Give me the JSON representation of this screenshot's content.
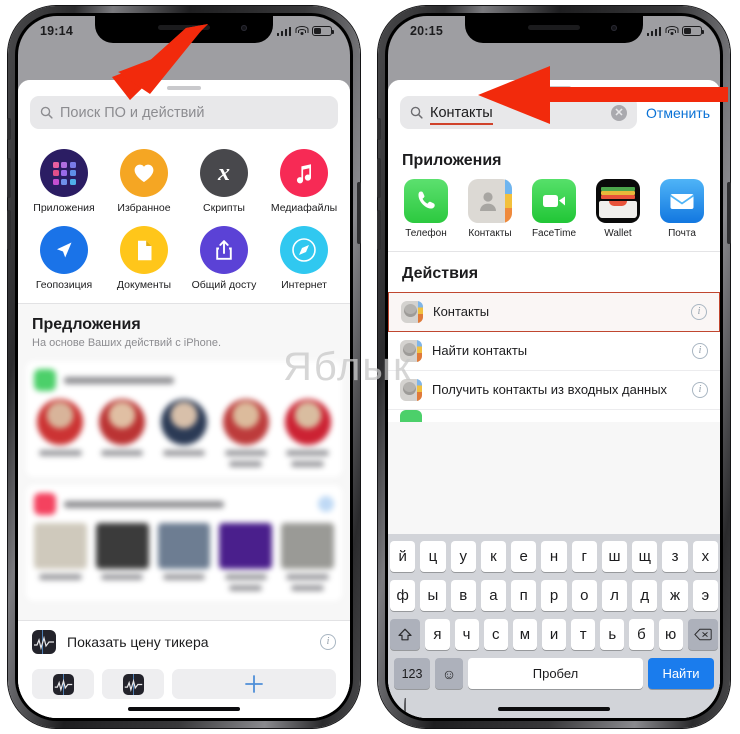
{
  "watermark": {
    "text": "Яблык"
  },
  "left_phone": {
    "status": {
      "time": "19:14",
      "cellular_icon": "signal-bars-icon",
      "wifi_icon": "wifi-icon",
      "battery_icon": "battery-icon"
    },
    "search": {
      "placeholder": "Поиск ПО и действий",
      "icon": "search-icon"
    },
    "categories": [
      {
        "label": "Приложения",
        "icon": "apps-grid-icon",
        "color": "#2b1d63"
      },
      {
        "label": "Избранное",
        "icon": "heart-icon",
        "color": "#f5a623"
      },
      {
        "label": "Скрипты",
        "icon": "x-script-icon",
        "color": "#48484c"
      },
      {
        "label": "Медиафайлы",
        "icon": "music-note-icon",
        "color": "#f72a55"
      },
      {
        "label": "Геопозиция",
        "icon": "navigation-arrow-icon",
        "color": "#1a73e8"
      },
      {
        "label": "Документы",
        "icon": "document-icon",
        "color": "#ffc61a"
      },
      {
        "label": "Общий досту",
        "icon": "share-icon",
        "color": "#5b42d6"
      },
      {
        "label": "Интернет",
        "icon": "safari-compass-icon",
        "color": "#30c8f0"
      }
    ],
    "suggestions": {
      "title": "Предложения",
      "subtitle": "На основе Ваших действий с iPhone."
    },
    "bottom_action": {
      "label": "Показать цену тикера",
      "icon": "stocks-ticker-icon",
      "info_icon": "info-circle-icon"
    },
    "tabbar": {
      "tab1_icon": "stocks-ticker-icon",
      "tab2_icon": "stocks-ticker-icon",
      "add_icon": "plus-icon"
    }
  },
  "right_phone": {
    "status": {
      "time": "20:15",
      "cellular_icon": "signal-bars-icon",
      "wifi_icon": "wifi-icon",
      "battery_icon": "battery-icon"
    },
    "search": {
      "value": "Контакты",
      "icon": "search-icon",
      "clear_icon": "clear-circle-icon",
      "cancel_label": "Отменить"
    },
    "apps_section": {
      "title": "Приложения",
      "apps": [
        {
          "label": "Телефон",
          "icon": "phone-icon",
          "color": "#4cd964"
        },
        {
          "label": "Контакты",
          "icon": "contacts-icon",
          "color": "#d8d5d0"
        },
        {
          "label": "FaceTime",
          "icon": "facetime-icon",
          "color": "#34d149"
        },
        {
          "label": "Wallet",
          "icon": "wallet-icon",
          "color": "#0a0a0a"
        },
        {
          "label": "Почта",
          "icon": "mail-icon",
          "color": "#2196f3"
        }
      ]
    },
    "actions_section": {
      "title": "Действия",
      "rows": [
        {
          "label": "Контакты",
          "icon": "contacts-action-icon",
          "info_icon": "info-circle-icon",
          "highlighted": true
        },
        {
          "label": "Найти контакты",
          "icon": "contacts-action-icon",
          "info_icon": "info-circle-icon",
          "highlighted": false
        },
        {
          "label": "Получить контакты из входных данных",
          "icon": "contacts-action-icon",
          "info_icon": "info-circle-icon",
          "highlighted": false
        }
      ]
    },
    "keyboard": {
      "row1": [
        "й",
        "ц",
        "у",
        "к",
        "е",
        "н",
        "г",
        "ш",
        "щ",
        "з",
        "х"
      ],
      "row2": [
        "ф",
        "ы",
        "в",
        "а",
        "п",
        "р",
        "о",
        "л",
        "д",
        "ж",
        "э"
      ],
      "row3": [
        "я",
        "ч",
        "с",
        "м",
        "и",
        "т",
        "ь",
        "б",
        "ю"
      ],
      "shift_icon": "shift-up-icon",
      "backspace_icon": "backspace-icon",
      "numbers_label": "123",
      "emoji_icon": "emoji-smiley-icon",
      "space_label": "Пробел",
      "go_label": "Найти",
      "globe_icon": "globe-icon"
    }
  },
  "annotations": {
    "arrow_left": "red-arrow-pointing-to-search-field",
    "arrow_right": "red-arrow-pointing-to-search-query"
  },
  "colors": {
    "accent_blue": "#0a72d6",
    "highlight_red": "#c0462f",
    "arrow_red": "#f22a0c"
  }
}
